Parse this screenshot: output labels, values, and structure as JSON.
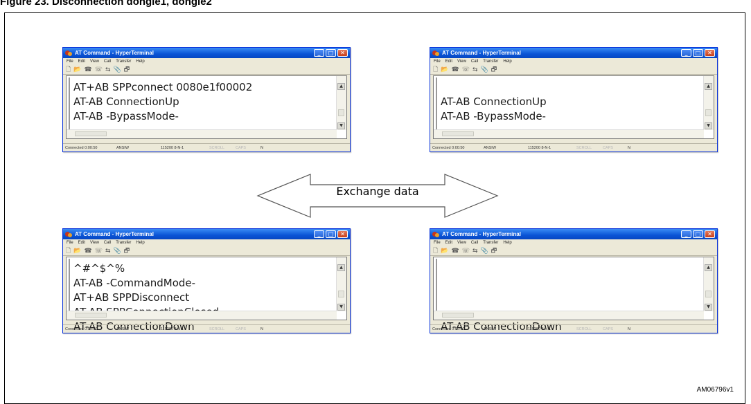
{
  "figure": {
    "title": "Figure 23.   Disconnection dongle1, dongle2",
    "id": "AM06796v1"
  },
  "window": {
    "title": "AT Command - HyperTerminal",
    "menu": [
      "File",
      "Edit",
      "View",
      "Call",
      "Transfer",
      "Help"
    ],
    "toolbar_glyphs": [
      "🗋",
      "📂",
      "☎",
      "☏",
      "⇆",
      "📎",
      "🗗"
    ],
    "status": {
      "connected": "Connected 0:00:50",
      "emulation": "ANSIW",
      "settings": "115200 8-N-1",
      "scroll": "SCROLL",
      "caps": "CAPS",
      "num": "N"
    },
    "buttons": {
      "minimize": "_",
      "maximize": "□",
      "close": "✕"
    }
  },
  "terminals": {
    "top_left": {
      "lines": [
        "AT+AB SPPconnect 0080e1f00002",
        "AT-AB ConnectionUp",
        "AT-AB -BypassMode-"
      ]
    },
    "top_right": {
      "lines": [
        "AT-AB ConnectionUp",
        "AT-AB -BypassMode-"
      ]
    },
    "bottom_left": {
      "lines": [
        "^#^$^%",
        "AT-AB -CommandMode-",
        "AT+AB SPPDisconnect",
        "AT-AB SPPConnectionClosed",
        "AT-AB ConnectionDown"
      ]
    },
    "bottom_right": {
      "lines": [
        "AT-AB ConnectionDown"
      ]
    }
  },
  "exchange": {
    "label": "Exchange data"
  }
}
